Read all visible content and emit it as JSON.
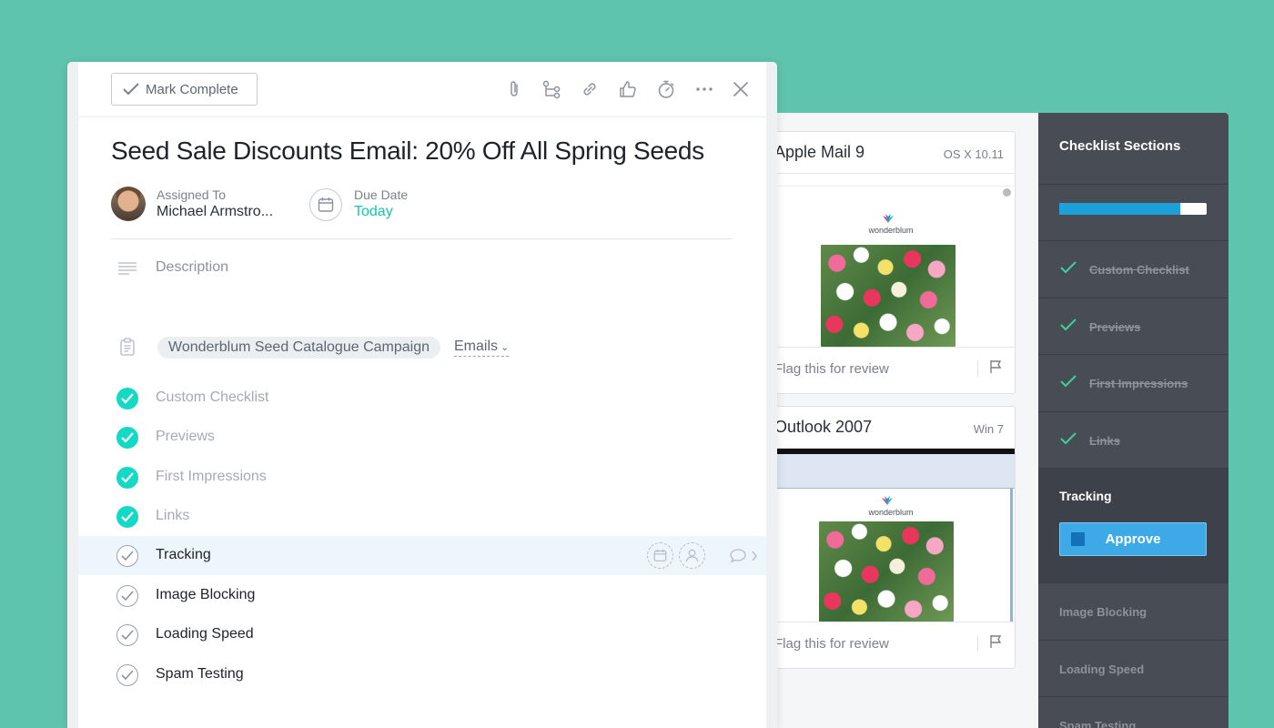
{
  "task": {
    "mark_complete_label": "Mark Complete",
    "title": "Seed Sale Discounts Email: 20% Off All Spring Seeds",
    "assigned_label": "Assigned To",
    "assignee": "Michael Armstro...",
    "due_label": "Due Date",
    "due_value": "Today",
    "description_placeholder": "Description",
    "project": "Wonderblum Seed Catalogue Campaign",
    "section": "Emails",
    "subtasks": [
      {
        "label": "Custom Checklist",
        "done": true
      },
      {
        "label": "Previews",
        "done": true
      },
      {
        "label": "First Impressions",
        "done": true
      },
      {
        "label": "Links",
        "done": true
      },
      {
        "label": "Tracking",
        "done": false
      },
      {
        "label": "Image Blocking",
        "done": false
      },
      {
        "label": "Loading Speed",
        "done": false
      },
      {
        "label": "Spam Testing",
        "done": false
      }
    ],
    "toolbar_icons": [
      "paperclip-icon",
      "subtask-icon",
      "link-icon",
      "like-icon",
      "timer-icon",
      "more-icon",
      "close-icon"
    ]
  },
  "previews": [
    {
      "client": "Apple Mail 9",
      "os": "OS X 10.11",
      "brand": "wonderblum",
      "flag_label": "Flag this for review"
    },
    {
      "client": "Outlook 2007",
      "os": "Win 7",
      "brand": "wonderblum",
      "flag_label": "Flag this for review"
    }
  ],
  "checklist": {
    "title": "Checklist Sections",
    "progress": 0.82,
    "completed": [
      "Custom Checklist",
      "Previews",
      "First Impressions",
      "Links"
    ],
    "active": {
      "label": "Tracking",
      "button": "Approve"
    },
    "pending": [
      "Image Blocking",
      "Loading Speed",
      "Spam Testing"
    ]
  },
  "colors": {
    "background": "#5fc4ad",
    "check_done": "#14d9c4",
    "due_today": "#14c4b0",
    "approve": "#3da9e6",
    "progress_fill": "#1d9fd8",
    "sidebar": "#474c55"
  }
}
